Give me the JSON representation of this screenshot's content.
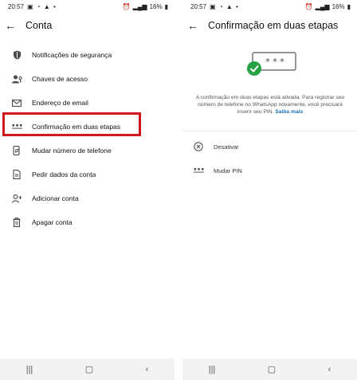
{
  "left": {
    "status": {
      "time": "20:57",
      "battery": "16%"
    },
    "title": "Conta",
    "items": [
      {
        "label": "Notificações de segurança"
      },
      {
        "label": "Chaves de acesso"
      },
      {
        "label": "Endereço de email"
      },
      {
        "label": "Confirmação em duas etapas"
      },
      {
        "label": "Mudar número de telefone"
      },
      {
        "label": "Pedir dados da conta"
      },
      {
        "label": "Adicionar conta"
      },
      {
        "label": "Apagar conta"
      }
    ]
  },
  "right": {
    "status": {
      "time": "20:57",
      "battery": "16%"
    },
    "title": "Confirmação em duas etapas",
    "pin_mask": "* * *",
    "description": "A confirmação em duas etapas está ativada. Para registrar seu número de telefone no WhatsApp novamente, você precisará inserir seu PIN.",
    "learn_more": "Saiba mais",
    "options": [
      {
        "label": "Desativar"
      },
      {
        "label": "Mudar PIN"
      }
    ]
  },
  "colors": {
    "highlight": "#d0181c",
    "accent_green": "#25a244",
    "link": "#1a73b8"
  },
  "icons": {
    "left": [
      "shield-icon",
      "person-key-icon",
      "mail-icon",
      "dots-pin-icon",
      "phone-swap-icon",
      "document-icon",
      "person-add-icon",
      "trash-icon"
    ],
    "right": [
      "close-circle-icon",
      "dots-pin-icon"
    ]
  }
}
